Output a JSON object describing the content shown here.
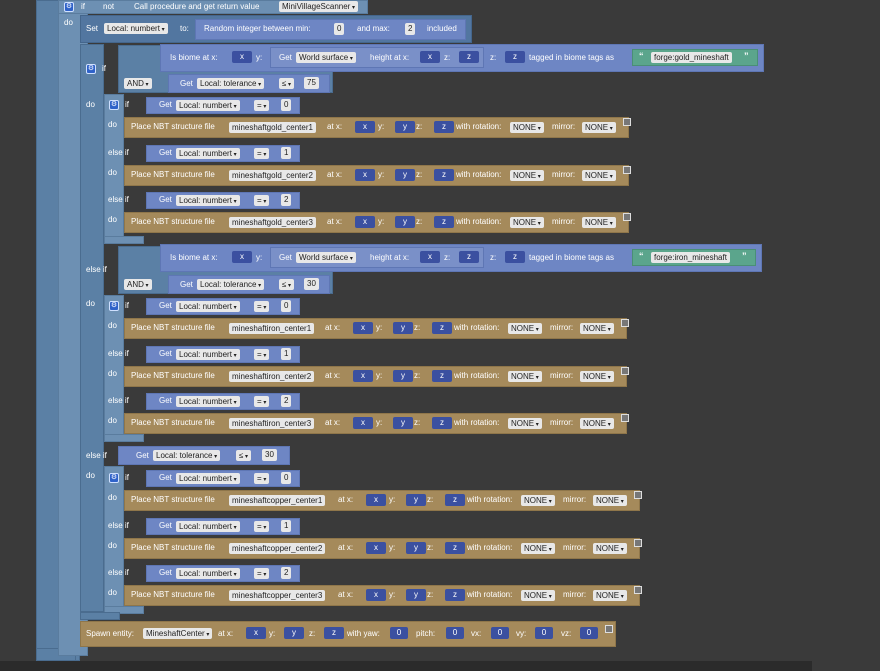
{
  "kw": {
    "if": "if",
    "not": "not",
    "do": "do",
    "else_if": "else if",
    "and": "AND"
  },
  "top_if": {
    "call_label": "Call procedure and get return value",
    "procedure": "MiniVillageScanner"
  },
  "set_block": {
    "label": "Set",
    "variable": "Local: numbert",
    "to": "to:",
    "random_label": "Random integer between min:",
    "min": "0",
    "and_max": "and max:",
    "max": "2",
    "included": "included"
  },
  "biome": {
    "is_biome_at_x": "Is biome at x:",
    "y_label": "y:",
    "get_label": "Get",
    "world_surface": "World surface",
    "height_at_x": "height at x:",
    "z_label": "z:",
    "tagged_label": "tagged in biome tags as",
    "x": "x",
    "z": "z",
    "gold_tag": "forge:gold_mineshaft",
    "iron_tag": "forge:iron_mineshaft"
  },
  "tolerance": {
    "get_label": "Get",
    "variable": "Local: tolerance",
    "op": "≤",
    "gold_value": "75",
    "iron_value": "30",
    "copper_value": "30"
  },
  "numbert_check": {
    "get_label": "Get",
    "variable": "Local: numbert",
    "op": "=",
    "values": [
      "0",
      "1",
      "2"
    ]
  },
  "place": {
    "label": "Place NBT structure file",
    "at_x": "at x:",
    "y": "y:",
    "z": "z:",
    "with_rotation": "with rotation:",
    "rotation": "NONE",
    "mirror_label": "mirror:",
    "mirror": "NONE",
    "vx": "x",
    "vy": "y",
    "vz": "z",
    "gold_files": [
      "mineshaftgold_center1",
      "mineshaftgold_center2",
      "mineshaftgold_center3"
    ],
    "iron_files": [
      "mineshaftiron_center1",
      "mineshaftiron_center2",
      "mineshaftiron_center3"
    ],
    "copper_files": [
      "mineshaftcopper_center1",
      "mineshaftcopper_center2",
      "mineshaftcopper_center3"
    ]
  },
  "spawn": {
    "label": "Spawn entity:",
    "entity": "MineshaftCenter",
    "at_x": "at x:",
    "x": "x",
    "y_label": "y:",
    "y": "y",
    "z_label": "z:",
    "z": "z",
    "yaw_label": "with yaw:",
    "yaw": "0",
    "pitch_label": "pitch:",
    "pitch": "0",
    "vx_label": "vx:",
    "vx": "0",
    "vy_label": "vy:",
    "vy": "0",
    "vz_label": "vz:",
    "vz": "0"
  }
}
